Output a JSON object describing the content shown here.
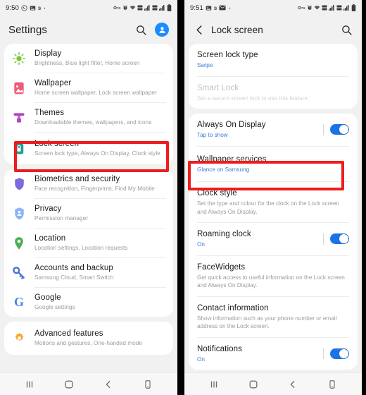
{
  "left_phone": {
    "status_bar": {
      "time": "9:50",
      "left_icons": [
        "whatsapp-icon",
        "gallery-icon",
        "s-badge-icon",
        "dot-icon"
      ],
      "right_icons": [
        "vpn-key-icon",
        "alarm-icon",
        "wifi-icon",
        "mobile-data-1-icon",
        "signal-1-icon",
        "mobile-data-2-icon",
        "signal-2-icon",
        "battery-icon"
      ]
    },
    "appbar": {
      "title": "Settings",
      "search_icon": "search-icon",
      "avatar_icon": "account-avatar-icon"
    },
    "groups": [
      {
        "items": [
          {
            "title": "Display",
            "subtitle": "Brightness, Blue light filter, Home screen",
            "icon": "display-sun-icon",
            "icon_color": "#76c832"
          },
          {
            "title": "Wallpaper",
            "subtitle": "Home screen wallpaper, Lock screen wallpaper",
            "icon": "wallpaper-image-icon",
            "icon_color": "#ef5b78"
          },
          {
            "title": "Themes",
            "subtitle": "Downloadable themes, wallpapers, and icons",
            "icon": "themes-roller-icon",
            "icon_color": "#ab47bc"
          },
          {
            "title": "Lock screen",
            "subtitle": "Screen lock type, Always On Display, Clock style",
            "icon": "lock-screen-padlock-icon",
            "icon_color": "#1aa198",
            "highlighted": true
          }
        ]
      },
      {
        "items": [
          {
            "title": "Biometrics and security",
            "subtitle": "Face recognition, Fingerprints, Find My Mobile",
            "icon": "security-shield-icon",
            "icon_color": "#7c6bdc"
          },
          {
            "title": "Privacy",
            "subtitle": "Permission manager",
            "icon": "privacy-shield-person-icon",
            "icon_color": "#8ab4f8"
          },
          {
            "title": "Location",
            "subtitle": "Location settings, Location requests",
            "icon": "location-pin-icon",
            "icon_color": "#4caf50"
          },
          {
            "title": "Accounts and backup",
            "subtitle": "Samsung Cloud, Smart Switch",
            "icon": "accounts-key-icon",
            "icon_color": "#4a76d8"
          },
          {
            "title": "Google",
            "subtitle": "Google settings",
            "icon": "google-g-icon",
            "icon_color": "#4285f4"
          }
        ]
      },
      {
        "items": [
          {
            "title": "Advanced features",
            "subtitle": "Motions and gestures, One-handed mode",
            "icon": "advanced-gear-icon",
            "icon_color": "#f5a623"
          }
        ]
      }
    ],
    "nav_bar": [
      "recents-icon",
      "home-icon",
      "back-icon",
      "screenshot-icon"
    ]
  },
  "right_phone": {
    "status_bar": {
      "time": "9:51",
      "left_icons": [
        "gallery-icon",
        "s-badge-icon",
        "email-icon",
        "dot-icon"
      ],
      "right_icons": [
        "vpn-key-icon",
        "alarm-icon",
        "wifi-icon",
        "mobile-data-1-icon",
        "signal-1-icon",
        "mobile-data-2-icon",
        "signal-2-icon",
        "battery-icon"
      ]
    },
    "appbar": {
      "back_icon": "back-chevron-icon",
      "title": "Lock screen",
      "search_icon": "search-icon"
    },
    "groups": [
      {
        "items": [
          {
            "title": "Screen lock type",
            "subtitle": "Swipe",
            "subtitle_style": "link"
          },
          {
            "title": "Smart Lock",
            "subtitle": "Set a secure screen lock to use this feature.",
            "disabled": true
          }
        ]
      },
      {
        "items": [
          {
            "title": "Always On Display",
            "subtitle": "Tap to show",
            "subtitle_style": "link",
            "toggle": true,
            "toggle_on": true
          },
          {
            "title": "Wallpaper services",
            "subtitle": "Glance on Samsung",
            "subtitle_style": "link",
            "highlighted": true
          },
          {
            "title": "Clock style",
            "subtitle": "Set the type and colour for the clock on the Lock screen and Always On Display."
          },
          {
            "title": "Roaming clock",
            "subtitle": "On",
            "subtitle_style": "link",
            "toggle": true,
            "toggle_on": true
          },
          {
            "title": "FaceWidgets",
            "subtitle": "Get quick access to useful information on the Lock screen and Always On Display."
          },
          {
            "title": "Contact information",
            "subtitle": "Show information such as your phone number or email address on the Lock screen."
          },
          {
            "title": "Notifications",
            "subtitle": "On",
            "subtitle_style": "link",
            "toggle": true,
            "toggle_on": true
          }
        ]
      }
    ],
    "nav_bar": [
      "recents-icon",
      "home-icon",
      "back-icon",
      "screenshot-icon"
    ]
  },
  "annotations": {
    "highlight_color": "#ee1c1c",
    "boxes": [
      {
        "target": "Lock screen",
        "phone": "left"
      },
      {
        "target": "Wallpaper services",
        "phone": "right"
      }
    ]
  }
}
